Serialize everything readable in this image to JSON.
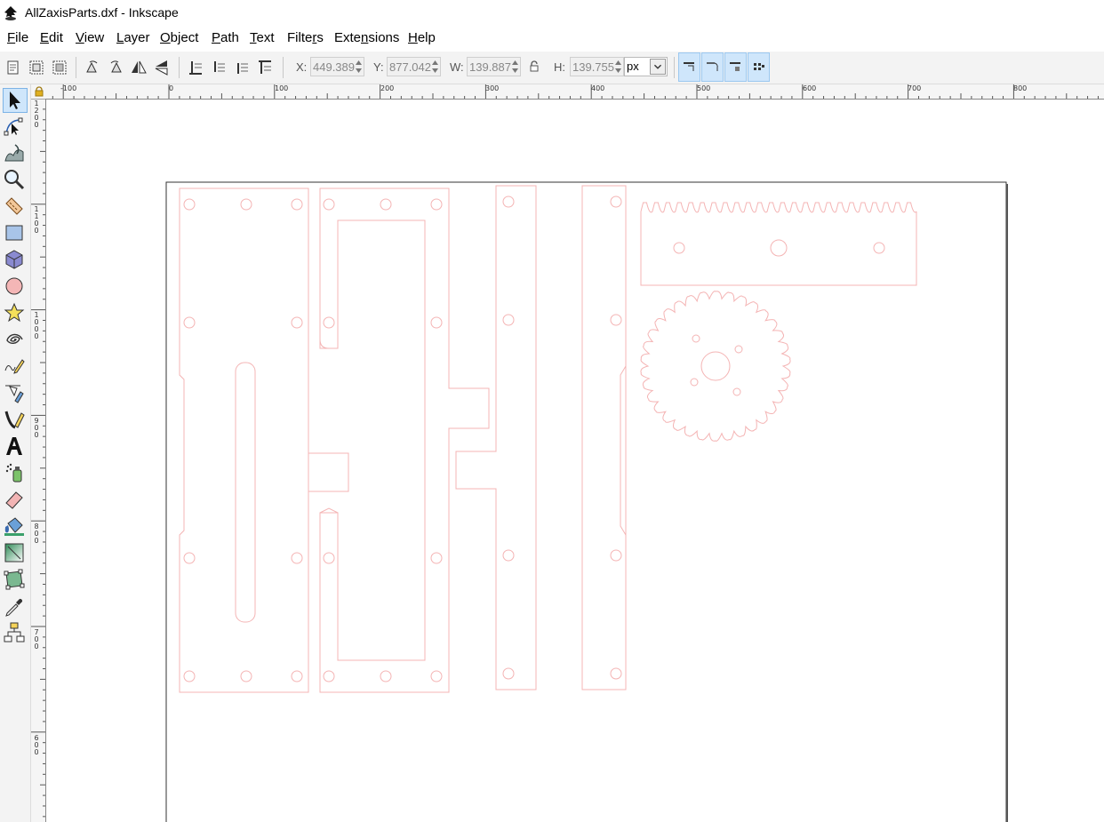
{
  "window": {
    "title": "AllZaxisParts.dxf - Inkscape",
    "app_icon": "inkscape-icon"
  },
  "menu": [
    {
      "pre": "",
      "ul": "F",
      "post": "ile"
    },
    {
      "pre": "",
      "ul": "E",
      "post": "dit"
    },
    {
      "pre": "",
      "ul": "V",
      "post": "iew"
    },
    {
      "pre": "",
      "ul": "L",
      "post": "ayer"
    },
    {
      "pre": "",
      "ul": "O",
      "post": "bject"
    },
    {
      "pre": "",
      "ul": "P",
      "post": "ath"
    },
    {
      "pre": "",
      "ul": "T",
      "post": "ext"
    },
    {
      "pre": "Filte",
      "ul": "r",
      "post": "s"
    },
    {
      "pre": "Exte",
      "ul": "n",
      "post": "sions"
    },
    {
      "pre": "",
      "ul": "H",
      "post": "elp"
    }
  ],
  "controls": {
    "x_label": "X:",
    "x_value": "449.389",
    "y_label": "Y:",
    "y_value": "877.042",
    "w_label": "W:",
    "w_value": "139.887",
    "h_label": "H:",
    "h_value": "139.755",
    "unit": "px",
    "lock_icon": "lock-icon"
  },
  "toolbar_icons": [
    "select-all-icon",
    "select-all-layers-icon",
    "deselect-icon",
    "rotate-ccw-icon",
    "rotate-cw-icon",
    "flip-horizontal-icon",
    "flip-vertical-icon",
    "lower-to-bottom-icon",
    "lower-icon",
    "raise-icon",
    "raise-to-top-icon"
  ],
  "snap_icons": [
    "scale-stroke-icon",
    "scale-corners-icon",
    "move-gradients-icon",
    "move-patterns-icon"
  ],
  "tools": [
    "selector-tool-icon",
    "node-tool-icon",
    "tweak-tool-icon",
    "zoom-tool-icon",
    "measure-tool-icon",
    "rectangle-tool-icon",
    "box-3d-tool-icon",
    "ellipse-tool-icon",
    "star-tool-icon",
    "spiral-tool-icon",
    "pencil-tool-icon",
    "pen-tool-icon",
    "calligraphy-tool-icon",
    "text-tool-icon",
    "spray-tool-icon",
    "eraser-tool-icon",
    "paint-bucket-tool-icon",
    "gradient-tool-icon",
    "mesh-tool-icon",
    "dropper-tool-icon",
    "connector-tool-icon"
  ],
  "hruler_labels": [
    "-100",
    "0",
    "100",
    "200",
    "300",
    "400",
    "500",
    "600",
    "700",
    "800"
  ],
  "vruler_labels": [
    "1200",
    "1100",
    "1000",
    "900",
    "800",
    "700",
    "600"
  ],
  "colors": {
    "part_stroke": "#f4b4b4",
    "page_border": "#333333",
    "active_tool": "#cfe6fb"
  }
}
